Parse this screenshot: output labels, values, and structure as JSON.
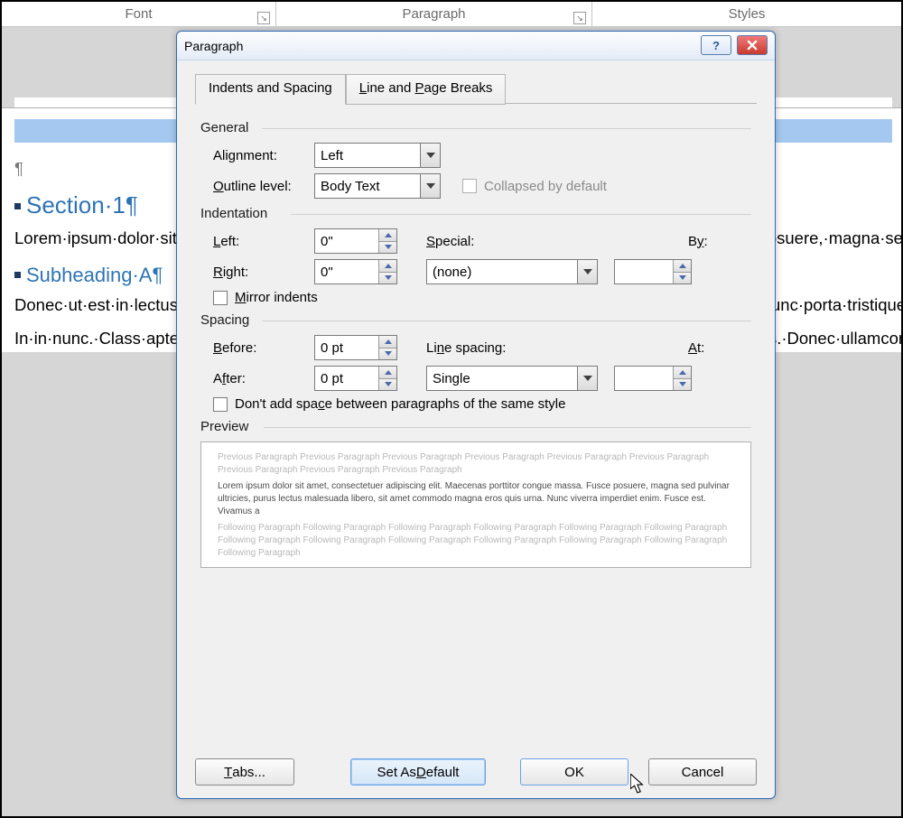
{
  "ribbon": {
    "font": "Font",
    "paragraph": "Paragraph",
    "styles": "Styles"
  },
  "document": {
    "pilcrow": "¶",
    "section_heading": "Section·1",
    "lorem1": "Lorem·ipsum·dolor·sit·amet,·consectetuer·adipiscing·elit.·Maecenas·porttitor·congue·massa.·Fusce·posuere,·magna·sed·pulvinar·ultricies,·purus·lectus·malesuada·libero,·sit·amet·commodo·magna·eros·quis·urna.·Nunc·viverra·imperdiet·enim.·Fusce·est.·Vivamus·a·tellus.·Pellentesque·habitant·morbi·tristique·senectus·et·netus·et·malesuada·fames·ac·turpis·egestas.·Proin·pharetra·nonummy·pede.·Mauris·et·orci.·Aenean·nec·lorem.·In·porttitor.·Donec·laoreet·nonummy·augue.·Suspendisse·dui·purus,·scelerisque·at,·vulputate·vitae,·pretium·mattis,·nunc.·Mauris·eget·neque·at·sem·venenatis·eleifend.·Ut·nonummy.·Fusce·aliquet·pede·non·pede.·Suspendisse·dapibus·lorem·pellentesque·magna.·Integer·nulla.·Donec·blandit·feugiat·ligula.·Donec·hendrerit,·felis·et·imperdiet·euismod,·purus·ipsum·pretium·metus,·in·lacinia·nulla·nisl·eget·sapien.¶",
    "subheading_a": "Subheading·A",
    "lorem2": "Donec·ut·est·in·lectus·consequat·consequat.·Etiam·eget·dui.·Aliquam·erat·volutpat.·Sed·at·lorem·in·nunc·porta·tristique.·Proin·nec·augue.·Quisque·aliquam·tempor·magna.·Pellentesque·habitant·morbi·tristique·senectus·et·netus·et·malesuada·fames·ac·turpis·egestas.·Nunc·ac·magna.·Maecenas·odio·dolor,·vulputate·vel,·auctor·ac,·accumsan·id,·felis.·Pellentesque·cursus·sagittis·felis.·Pellentesque·porttitor,·velit·lacinia·egestas·auctor,·diam·eros·tempus·arcu,·nec·vulputate·augue·magna·vel·risus.·Cras·non·magna·vel·ante·adipiscing·rhoncus.·Vivamus·a·mi.·Morbi·neque.·Aliquam·erat·volutpat.·Integer·ultrices·lobortis·eros.·Pellentesque·habitant·morbi·tristique·senectus·et·netus·et·malesuada·fames·ac·turpis·egestas.·Proin·semper,·ante·vitae·sollicitudin·posuere,·metus·quam·iaculis·nibh,·vitae·scelerisque·nunc·massa·eget·pede.·Sed·velit·urna,·interdum·vel,·ultricies·vel,·faucibus·at,·quam.·Donec·elit·est,·consectetuer·eget,·consequat·quis,·tempus·quis,·wisi.¶",
    "lorem3": "In·in·nunc.·Class·aptent·taciti·sociosqu·ad·litora·torquent·per·conubia·nostra,·per·inceptos·hymenaeos.·Donec·ullamcorper·fringilla·eros.·Fusce·in·sapien·eu·purus·dapibus·commodo.·Cum·sociis·natoque·"
  },
  "dialog": {
    "title": "Paragraph",
    "tabs": {
      "indents": "Indents and Spacing",
      "linebreaks": "Line and Page Breaks"
    },
    "general": {
      "label": "General",
      "alignment_label": "Alignment:",
      "alignment_value": "Left",
      "outline_label": "Outline level:",
      "outline_value": "Body Text",
      "collapsed_label": "Collapsed by default"
    },
    "indentation": {
      "label": "Indentation",
      "left_label": "Left:",
      "left_value": "0\"",
      "right_label": "Right:",
      "right_value": "0\"",
      "special_label": "Special:",
      "special_value": "(none)",
      "by_label": "By:",
      "by_value": "",
      "mirror_label": "Mirror indents"
    },
    "spacing": {
      "label": "Spacing",
      "before_label": "Before:",
      "before_value": "0 pt",
      "after_label": "After:",
      "after_value": "0 pt",
      "linespacing_label": "Line spacing:",
      "linespacing_value": "Single",
      "at_label": "At:",
      "at_value": "",
      "nospace_label": "Don't add space between paragraphs of the same style"
    },
    "preview": {
      "label": "Preview",
      "prev": "Previous Paragraph Previous Paragraph Previous Paragraph Previous Paragraph Previous Paragraph Previous Paragraph Previous Paragraph Previous Paragraph Previous Paragraph",
      "sample": "Lorem ipsum dolor sit amet, consectetuer adipiscing elit. Maecenas porttitor congue massa. Fusce posuere, magna sed pulvinar ultricies, purus lectus malesuada libero, sit amet commodo magna eros quis urna. Nunc viverra imperdiet enim. Fusce est. Vivamus a",
      "foll": "Following Paragraph Following Paragraph Following Paragraph Following Paragraph Following Paragraph Following Paragraph Following Paragraph Following Paragraph Following Paragraph Following Paragraph Following Paragraph Following Paragraph Following Paragraph"
    },
    "buttons": {
      "tabs": "Tabs...",
      "setdefault": "Set As Default",
      "ok": "OK",
      "cancel": "Cancel"
    }
  }
}
